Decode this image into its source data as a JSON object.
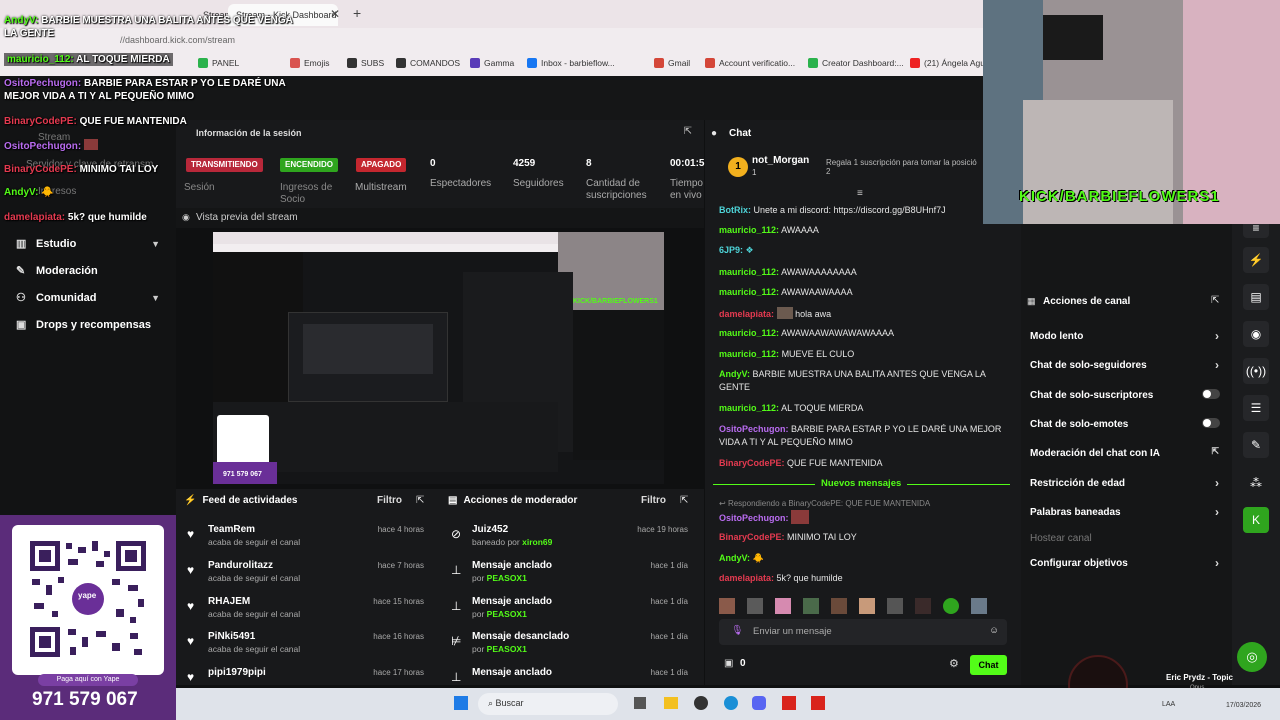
{
  "browser": {
    "tabs": [
      "Stream - Kick",
      "Stream - Kick Dashboard"
    ],
    "url": "//dashboard.kick.com/stream",
    "bookmarks": [
      "PANEL",
      "Emojis",
      "SUBS",
      "COMANDOS",
      "Gamma",
      "Inbox - barbieflow...",
      "Gmail",
      "Account verificatio...",
      "Creator Dashboard:...",
      "(21) Ángela Agu"
    ]
  },
  "overlay_chat": [
    {
      "user": "AndyV:",
      "text": "BARBIE MUESTRA UNA BALITA ANTES QUE VENGA LA GENTE",
      "color": "g"
    },
    {
      "user": "mauricio_112:",
      "text": "AL TOQUE MIERDA",
      "color": "g"
    },
    {
      "user": "OsitoPechugon:",
      "text": "BARBIE PARA ESTAR P YO LE DARÉ UNA MEJOR VIDA A TI Y AL PEQUEÑO MIMO",
      "color": "p"
    },
    {
      "user": "BinaryCodePE:",
      "text": "QUE FUE MANTENIDA",
      "color": "r"
    },
    {
      "user": "OsitoPechugon:",
      "text": "",
      "color": "p"
    },
    {
      "user": "BinaryCodePE:",
      "text": "MINIMO TAI LOY",
      "color": "r"
    },
    {
      "user": "AndyV:",
      "text": "",
      "color": "g"
    },
    {
      "user": "damelapiata:",
      "text": "5k? que humilde",
      "color": "r"
    }
  ],
  "sidebar": {
    "ghost_items": [
      "Stream",
      "Servidor y clave de retransm",
      "Ingresos"
    ],
    "items": [
      {
        "label": "Estudio",
        "icon": "chart-icon"
      },
      {
        "label": "Moderación",
        "icon": "wrench-icon"
      },
      {
        "label": "Comunidad",
        "icon": "users-icon"
      },
      {
        "label": "Drops y recompensas",
        "icon": "gift-icon"
      }
    ]
  },
  "session": {
    "title": "Información de la sesión",
    "badges": [
      "TRANSMITIENDO",
      "ENCENDIDO",
      "APAGADO"
    ],
    "stats": [
      {
        "value": "0",
        "label": "Espectadores"
      },
      {
        "value": "4259",
        "label": "Seguidores"
      },
      {
        "value": "8",
        "label": "Cantidad de suscripciones"
      },
      {
        "value": "00:01:5",
        "label": "Tiempo en vivo"
      }
    ],
    "labels": [
      "Sesión",
      "Ingresos de Socio",
      "Multistream"
    ]
  },
  "preview": {
    "title": "Vista previa del stream",
    "qr_number": "971 579 067"
  },
  "feed": {
    "title": "Feed de actividades",
    "filter": "Filtro",
    "items": [
      {
        "name": "TeamRem",
        "sub": "acaba de seguir el canal",
        "time": "hace 4 horas"
      },
      {
        "name": "Pandurolitazz",
        "sub": "acaba de seguir el canal",
        "time": "hace 7 horas"
      },
      {
        "name": "RHAJEM",
        "sub": "acaba de seguir el canal",
        "time": "hace 15 horas"
      },
      {
        "name": "PiNki5491",
        "sub": "acaba de seguir el canal",
        "time": "hace 16 horas"
      },
      {
        "name": "pipi1979pipi",
        "sub": "",
        "time": "hace 17 horas"
      }
    ]
  },
  "modactions": {
    "title": "Acciones de moderador",
    "filter": "Filtro",
    "items": [
      {
        "name": "Juiz452",
        "pre": "baneado por",
        "by": "xiron69",
        "time": "hace 19 horas",
        "icon": "ban-icon"
      },
      {
        "name": "Mensaje anclado",
        "pre": "por",
        "by": "PEASOX1",
        "time": "hace 1 día",
        "icon": "pin-icon"
      },
      {
        "name": "Mensaje anclado",
        "pre": "por",
        "by": "PEASOX1",
        "time": "hace 1 día",
        "icon": "pin-icon"
      },
      {
        "name": "Mensaje desanclado",
        "pre": "por",
        "by": "PEASOX1",
        "time": "hace 1 día",
        "icon": "unpin-icon"
      },
      {
        "name": "Mensaje anclado",
        "pre": "",
        "by": "",
        "time": "hace 1 día",
        "icon": "pin-icon"
      }
    ]
  },
  "chat": {
    "title": "Chat",
    "pinned_user": "not_Morgan",
    "pinned_count": "1",
    "gift_text": "Regala 1 suscripción para tomar la posició",
    "gift_count": "2",
    "messages": [
      {
        "user": "BotRix:",
        "text": "Unete a mi discord: https://discord.gg/B8UHnf7J",
        "color": "c"
      },
      {
        "user": "mauricio_112:",
        "text": "AWAAAA",
        "color": "g"
      },
      {
        "user": "6JP9:",
        "text": "",
        "color": "c"
      },
      {
        "user": "mauricio_112:",
        "text": "AWAWAAAAAAAA",
        "color": "g"
      },
      {
        "user": "mauricio_112:",
        "text": "AWAWAAWAAAA",
        "color": "g"
      },
      {
        "user": "damelapiata:",
        "text": "hola awa",
        "color": "r"
      },
      {
        "user": "mauricio_112:",
        "text": "AWAWAAWAWAWAWAAAA",
        "color": "g"
      },
      {
        "user": "mauricio_112:",
        "text": "MUEVE EL CULO",
        "color": "g"
      },
      {
        "user": "AndyV:",
        "text": "BARBIE MUESTRA UNA BALITA ANTES QUE VENGA LA GENTE",
        "color": "g"
      },
      {
        "user": "mauricio_112:",
        "text": "AL TOQUE MIERDA",
        "color": "g"
      },
      {
        "user": "OsitoPechugon:",
        "text": "BARBIE PARA ESTAR P YO LE DARÉ UNA MEJOR VIDA A TI Y AL PEQUEÑO MIMO",
        "color": "p"
      },
      {
        "user": "BinaryCodePE:",
        "text": "QUE FUE MANTENIDA",
        "color": "r"
      }
    ],
    "new_messages": "Nuevos mensajes",
    "reply_hint": "Respondiendo a BinaryCodePE: QUE FUE MANTENIDA",
    "messages2": [
      {
        "user": "OsitoPechugon:",
        "text": "",
        "color": "p"
      },
      {
        "user": "BinaryCodePE:",
        "text": "MINIMO TAI LOY",
        "color": "r"
      },
      {
        "user": "AndyV:",
        "text": "",
        "color": "g"
      },
      {
        "user": "damelapiata:",
        "text": "5k? que humilde",
        "color": "r"
      }
    ],
    "input_placeholder": "Enviar un mensaje",
    "points": "0",
    "send_label": "Chat"
  },
  "actions": {
    "title": "Acciones de canal",
    "items": [
      {
        "label": "Modo lento",
        "kind": "arrow"
      },
      {
        "label": "Chat de solo-seguidores",
        "kind": "arrow"
      },
      {
        "label": "Chat de solo-suscriptores",
        "kind": "toggle"
      },
      {
        "label": "Chat de solo-emotes",
        "kind": "toggle"
      },
      {
        "label": "Moderación del chat con IA",
        "kind": "link"
      },
      {
        "label": "Restricción de edad",
        "kind": "arrow"
      },
      {
        "label": "Palabras baneadas",
        "kind": "arrow"
      },
      {
        "label": "Hostear canal",
        "kind": "disabled"
      },
      {
        "label": "Configurar objetivos",
        "kind": "arrow"
      }
    ]
  },
  "webcam": {
    "handle": "KICK/BARBIEFLOWERS1"
  },
  "qr": {
    "pay_text": "Paga aquí con Yape",
    "phone": "971 579 067",
    "brand": "yape"
  },
  "taskbar": {
    "search": "Buscar",
    "date": "17/03/2026",
    "lang": "LAA"
  },
  "music": {
    "title": "Eric Prydz - Topic",
    "sub": "Opus"
  },
  "colors": {
    "accent": "#53fc18",
    "bg": "#18191b"
  }
}
